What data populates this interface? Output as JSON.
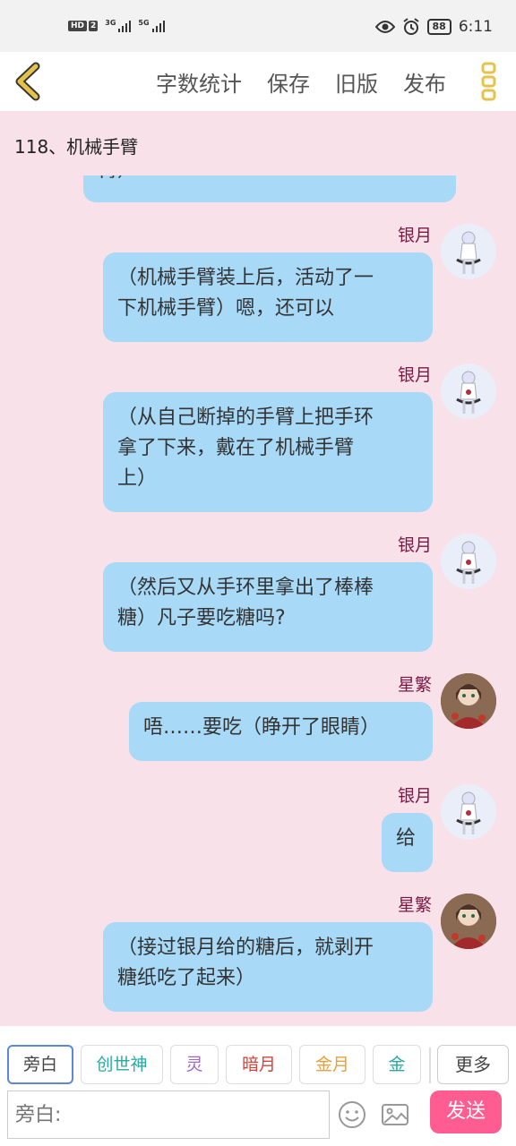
{
  "status_bar": {
    "hd": "HD",
    "sim2": "2",
    "net1": "3G",
    "net2": "5G",
    "battery": "88",
    "time": "6:11"
  },
  "toolbar": {
    "word_count": "字数统计",
    "save": "保存",
    "old_version": "旧版",
    "publish": "发布"
  },
  "chapter": {
    "title": "118、机械手臂"
  },
  "messages": [
    {
      "speaker": "",
      "text": "臂）"
    },
    {
      "speaker": "银月",
      "text_lines": [
        "（机械手臂装上后，活动了一",
        "下机械手臂）嗯，还可以"
      ]
    },
    {
      "speaker": "银月",
      "text_lines": [
        "（从自己断掉的手臂上把手环",
        "拿了下来，戴在了机械手臂",
        "上）"
      ]
    },
    {
      "speaker": "银月",
      "text_lines": [
        "（然后又从手环里拿出了棒棒",
        "糖）凡子要吃糖吗?"
      ]
    },
    {
      "speaker": "星繁",
      "text_lines": [
        "唔……要吃（睁开了眼睛）"
      ]
    },
    {
      "speaker": "银月",
      "text_lines": [
        "给"
      ]
    },
    {
      "speaker": "星繁",
      "text_lines": [
        "（接过银月给的糖后，就剥开",
        "糖纸吃了起来）"
      ]
    }
  ],
  "roles": {
    "items": [
      {
        "label": "旁白",
        "color": "#444444"
      },
      {
        "label": "创世神",
        "color": "#2aa9a0"
      },
      {
        "label": "灵",
        "color": "#a267c9"
      },
      {
        "label": "暗月",
        "color": "#d0453c"
      },
      {
        "label": "金月",
        "color": "#e8a03a"
      },
      {
        "label": "金",
        "color": "#2aa9a0"
      }
    ],
    "more": "更多"
  },
  "composer": {
    "placeholder": "旁白:",
    "send": "发送"
  },
  "colors": {
    "background": "#f9e1e9",
    "bubble": "#a8daf8",
    "speaker": "#7a1845",
    "send": "#ff5d91",
    "back_arrow": "#e5c24a"
  }
}
